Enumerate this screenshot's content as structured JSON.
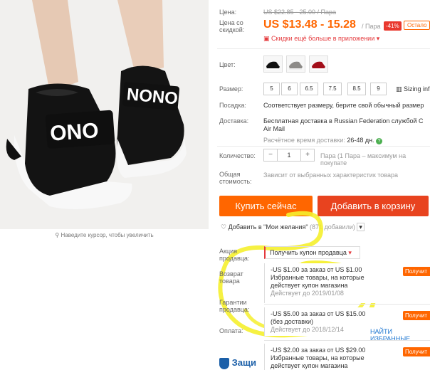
{
  "image": {
    "zoom_hint": "Наведите курсор, чтобы увеличить"
  },
  "price": {
    "label": "Цена:",
    "old": "US $22.85 - 25.00 / Пара",
    "discount_label_1": "Цена со",
    "discount_label_2": "скидкой:",
    "new": "US $13.48 - 15.28",
    "unit": "/ Пара",
    "badge": "-41%",
    "stop_badge": "Остало",
    "app_discount": "Скидки ещё больше в приложении"
  },
  "color": {
    "label": "Цвет:"
  },
  "size": {
    "label": "Размер:",
    "options": [
      "5",
      "6",
      "6.5",
      "7.5",
      "8.5",
      "9"
    ],
    "info": "Sizing inf"
  },
  "fit": {
    "label": "Посадка:",
    "value": "Соответствует размеру, берите свой обычный размер"
  },
  "shipping": {
    "label": "Доставка:",
    "line1": "Бесплатная доставка в Russian Federation службой C",
    "line2": "Air Mail",
    "estimate_label": "Расчётное время доставки:",
    "estimate_value": "26-48 дн."
  },
  "quantity": {
    "label": "Количество:",
    "value": "1",
    "note": "Пара (1 Пара – максимум на покупате"
  },
  "total": {
    "label1": "Общая",
    "label2": "стоимость:",
    "value": "Зависит от выбранных характеристик товара"
  },
  "buttons": {
    "buy": "Купить сейчас",
    "cart": "Добавить в корзину"
  },
  "wishlist": {
    "text": "Добавить в \"Мои желания\"",
    "count": "(871 добавили)"
  },
  "seller_promo": {
    "label1": "Акция",
    "label2": "продавца:",
    "coupon_button": "Получить купон продавца"
  },
  "return": {
    "label1": "Возврат",
    "label2": "товара"
  },
  "guarantee": {
    "label1": "Гарантии",
    "label2": "продавца:"
  },
  "payment": {
    "label": "Оплата:"
  },
  "coupons": [
    {
      "line1": "-US $1.00 за заказ от US $1.00",
      "line2": "Избранные товары, на которые",
      "line3": "действует купон магазина",
      "date": "Действует до 2019/01/08",
      "action": "Получит"
    },
    {
      "line1": "-US $5.00 за заказ от US $15.00",
      "line2": "(без доставки)",
      "line3": "",
      "date": "Действует до 2018/12/14",
      "action": "Получит"
    },
    {
      "line1": "-US $2.00 за заказ от US $29.00",
      "line2": "Избранные товары, на которые",
      "line3": "действует купон магазина",
      "date": "",
      "action": "Получит"
    }
  ],
  "find_favorites": "НАЙТИ ИЗБРАННЫЕ",
  "protection": "Защи",
  "colors": {
    "accent": "#ff6600",
    "cart": "#e8431f",
    "highlight": "#f5ef2e",
    "discount": "#e9382e"
  }
}
